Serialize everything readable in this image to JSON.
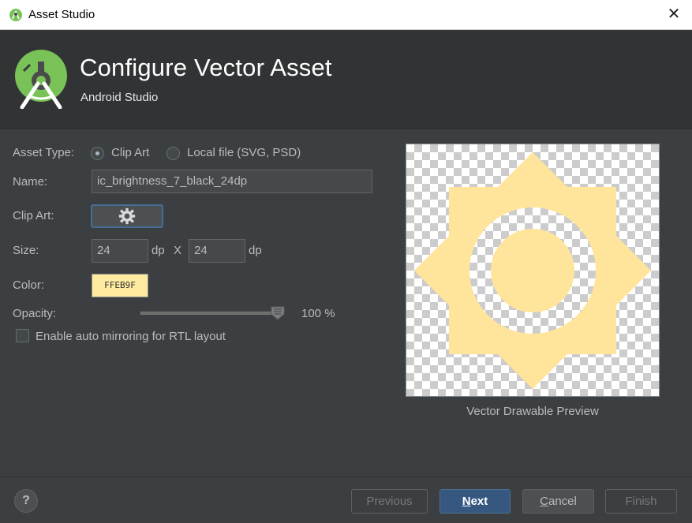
{
  "window": {
    "title": "Asset Studio",
    "close_icon": "close-icon"
  },
  "header": {
    "title": "Configure Vector Asset",
    "subtitle": "Android Studio",
    "logo": "android-studio-logo"
  },
  "form": {
    "asset_type": {
      "label": "Asset Type:",
      "options": [
        {
          "label": "Clip Art",
          "selected": true
        },
        {
          "label": "Local file (SVG, PSD)",
          "selected": false
        }
      ]
    },
    "name": {
      "label": "Name:",
      "value": "ic_brightness_7_black_24dp"
    },
    "clip_art": {
      "label": "Clip Art:",
      "icon": "gear-icon"
    },
    "size": {
      "label": "Size:",
      "width": "24",
      "height": "24",
      "unit": "dp",
      "separator": "X"
    },
    "color": {
      "label": "Color:",
      "value": "FFEB9F",
      "hex": "#FFEB9F"
    },
    "opacity": {
      "label": "Opacity:",
      "value": 100,
      "display": "100 %"
    },
    "rtl": {
      "label": "Enable auto mirroring for RTL layout",
      "checked": false
    }
  },
  "preview": {
    "caption": "Vector Drawable Preview",
    "fill": "#FFE49C",
    "icon": "brightness-7-icon"
  },
  "footer": {
    "help": "?",
    "previous": "Previous",
    "next_prefix": "",
    "next_mnemonic": "N",
    "next_rest": "ext",
    "cancel_mnemonic": "C",
    "cancel_rest": "ancel",
    "finish": "Finish"
  },
  "colors": {
    "background": "#3c3f41",
    "header_bg": "#313335",
    "primary_button": "#365880",
    "android_green": "#78c257"
  }
}
